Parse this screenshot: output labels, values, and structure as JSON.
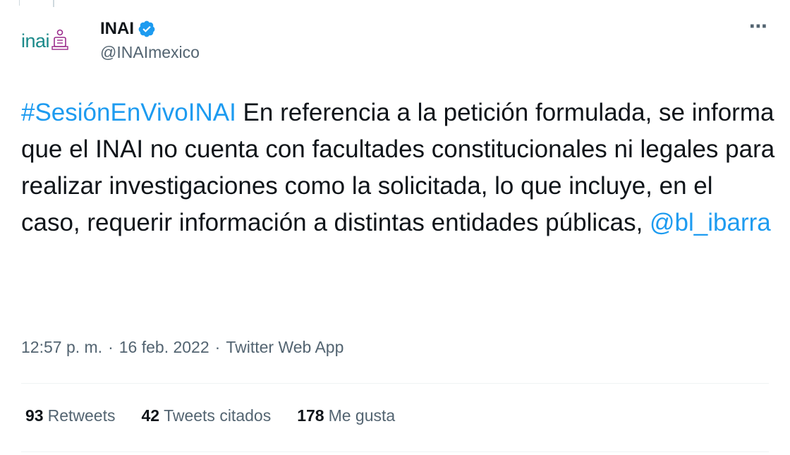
{
  "author": {
    "avatar_text": "inai",
    "display_name": "INAI",
    "handle": "@INAImexico",
    "verified": true
  },
  "more_icon": "⋯",
  "tweet": {
    "hashtag": "#SesiónEnVivoINAI",
    "text": " En referencia a la petición formulada, se informa que el INAI no cuenta con facultades constitucionales ni legales para realizar investigaciones como la solicitada, lo que incluye, en el caso, requerir información a distintas entidades públicas, ",
    "mention": "@bl_ibarra"
  },
  "meta": {
    "time": "12:57 p. m.",
    "separator": "·",
    "date": "16 feb. 2022",
    "source": "Twitter Web App"
  },
  "stats": {
    "retweets_count": "93",
    "retweets_label": "Retweets",
    "quotes_count": "42",
    "quotes_label": "Tweets citados",
    "likes_count": "178",
    "likes_label": "Me gusta"
  },
  "colors": {
    "link": "#1d9bf0",
    "brand": "#1b8a8a",
    "muted": "#536471",
    "verified": "#1d9bf0"
  }
}
